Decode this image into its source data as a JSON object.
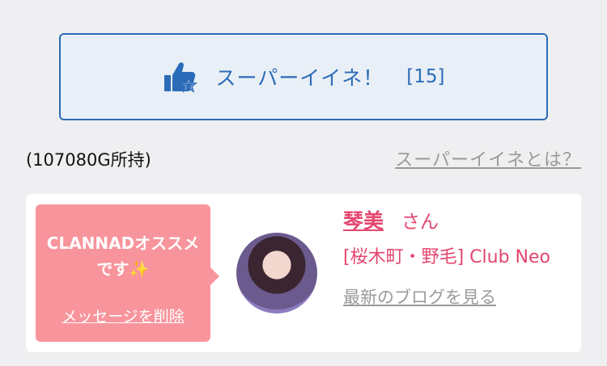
{
  "super_like": {
    "label": "スーパーイイネ！",
    "count": "[15]",
    "icon": "thumbs-up-star-icon",
    "color": "#2b6cb8"
  },
  "balance": "(107080G所持)",
  "about_link": "スーパーイイネとは？",
  "card": {
    "message": "CLANNADオススメです✨",
    "delete_label": "メッセージを削除",
    "name": "琴美",
    "honorific": "さん",
    "shop": "[桜木町・野毛] Club Neo",
    "blog_link": "最新のブログを見る",
    "accent_color": "#e4466e",
    "bubble_color": "#f8949c"
  }
}
